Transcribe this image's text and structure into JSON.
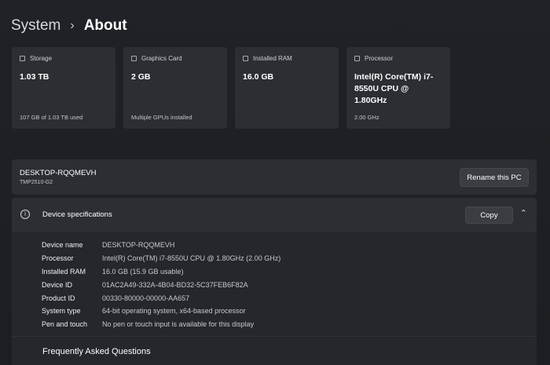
{
  "breadcrumb": {
    "parent": "System",
    "separator": "›",
    "current": "About"
  },
  "cards": [
    {
      "icon": "storage-icon",
      "title": "Storage",
      "value": "1.03 TB",
      "sub": "107 GB of 1.03 TB used"
    },
    {
      "icon": "graphics-card-icon",
      "title": "Graphics Card",
      "value": "2 GB",
      "sub": "Multiple GPUs installed"
    },
    {
      "icon": "ram-icon",
      "title": "Installed RAM",
      "value": "16.0 GB",
      "sub": ""
    },
    {
      "icon": "processor-icon",
      "title": "Processor",
      "value": "Intel(R) Core(TM) i7-8550U CPU @ 1.80GHz",
      "sub": "2.00 GHz"
    }
  ],
  "pc": {
    "name": "DESKTOP-RQQMEVH",
    "model": "TMP2510-G2",
    "rename_label": "Rename this PC"
  },
  "device_specs": {
    "icon": "info-icon",
    "title": "Device specifications",
    "copy_label": "Copy",
    "collapse_icon": "chevron-up-icon",
    "rows": [
      {
        "label": "Device name",
        "value": "DESKTOP-RQQMEVH"
      },
      {
        "label": "Processor",
        "value": "Intel(R) Core(TM) i7-8550U CPU @ 1.80GHz (2.00 GHz)"
      },
      {
        "label": "Installed RAM",
        "value": "16.0 GB (15.9 GB usable)"
      },
      {
        "label": "Device ID",
        "value": "01AC2A49-332A-4B04-BD32-5C37FEB6F82A"
      },
      {
        "label": "Product ID",
        "value": "00330-80000-00000-AA657"
      },
      {
        "label": "System type",
        "value": "64-bit operating system, x64-based processor"
      },
      {
        "label": "Pen and touch",
        "value": "No pen or touch input is available for this display"
      }
    ]
  },
  "faq": {
    "title": "Frequently Asked Questions"
  },
  "colors": {
    "background": "#1c2024",
    "panel": "#2b2e33",
    "button": "#3a3d42"
  }
}
